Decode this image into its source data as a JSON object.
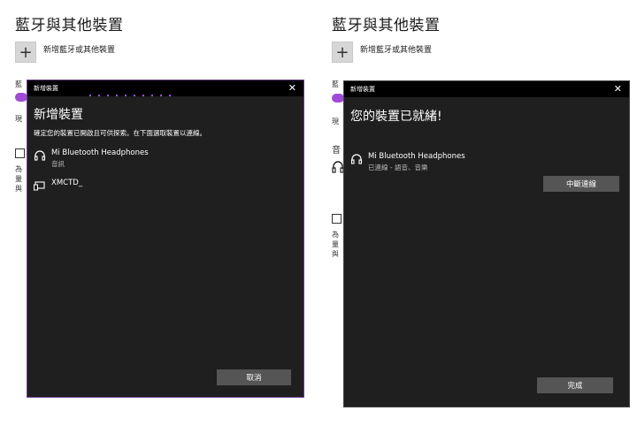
{
  "left_panel": {
    "settings_title": "藍牙與其他裝置",
    "add_device_label": "新增藍牙或其他裝置",
    "plus_symbol": "+",
    "bg_fragments": [
      "藍",
      "現",
      "為",
      "量",
      "與"
    ],
    "dialog": {
      "title": "新增裝置",
      "close": "✕",
      "heading": "新增裝置",
      "subtitle": "確定您的裝置已開啟且可供探索。在下面選取裝置以連線。",
      "devices": [
        {
          "name": "Mi Bluetooth Headphones",
          "sub": "音訊",
          "icon": "headphones-icon"
        },
        {
          "name": "XMCTD_",
          "sub": "",
          "icon": "display-icon"
        }
      ],
      "cancel_label": "取消"
    }
  },
  "right_panel": {
    "settings_title": "藍牙與其他裝置",
    "add_device_label": "新增藍牙或其他裝置",
    "plus_symbol": "+",
    "bg_fragments": [
      "藍",
      "現",
      "音",
      "為",
      "量",
      "與"
    ],
    "dialog": {
      "title": "新增裝置",
      "close": "✕",
      "heading": "您的裝置已就緒!",
      "device": {
        "name": "Mi Bluetooth Headphones",
        "sub": "已連線 - 語音、音樂",
        "icon": "headphones-icon"
      },
      "disconnect_label": "中斷連線",
      "done_label": "完成"
    }
  },
  "colors": {
    "accent": "#a04ad8",
    "dialog_bg": "#1f1f1f",
    "button_bg": "#555555"
  }
}
